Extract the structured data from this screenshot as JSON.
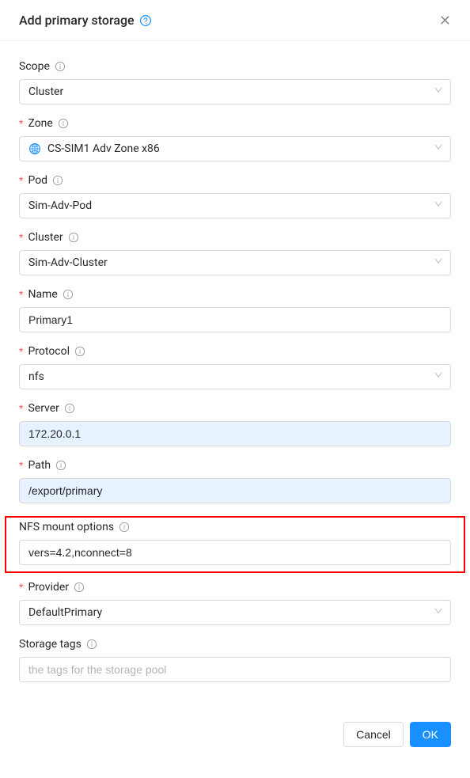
{
  "modal": {
    "title": "Add primary storage"
  },
  "fields": {
    "scope": {
      "label": "Scope",
      "value": "Cluster"
    },
    "zone": {
      "label": "Zone",
      "value": "CS-SIM1 Adv Zone x86"
    },
    "pod": {
      "label": "Pod",
      "value": "Sim-Adv-Pod"
    },
    "cluster": {
      "label": "Cluster",
      "value": "Sim-Adv-Cluster"
    },
    "name": {
      "label": "Name",
      "value": "Primary1"
    },
    "protocol": {
      "label": "Protocol",
      "value": "nfs"
    },
    "server": {
      "label": "Server",
      "value": "172.20.0.1"
    },
    "path": {
      "label": "Path",
      "value": "/export/primary"
    },
    "nfsmount": {
      "label": "NFS mount options",
      "value": "vers=4.2,nconnect=8"
    },
    "provider": {
      "label": "Provider",
      "value": "DefaultPrimary"
    },
    "tags": {
      "label": "Storage tags",
      "placeholder": "the tags for the storage pool"
    }
  },
  "buttons": {
    "cancel": "Cancel",
    "ok": "OK"
  }
}
